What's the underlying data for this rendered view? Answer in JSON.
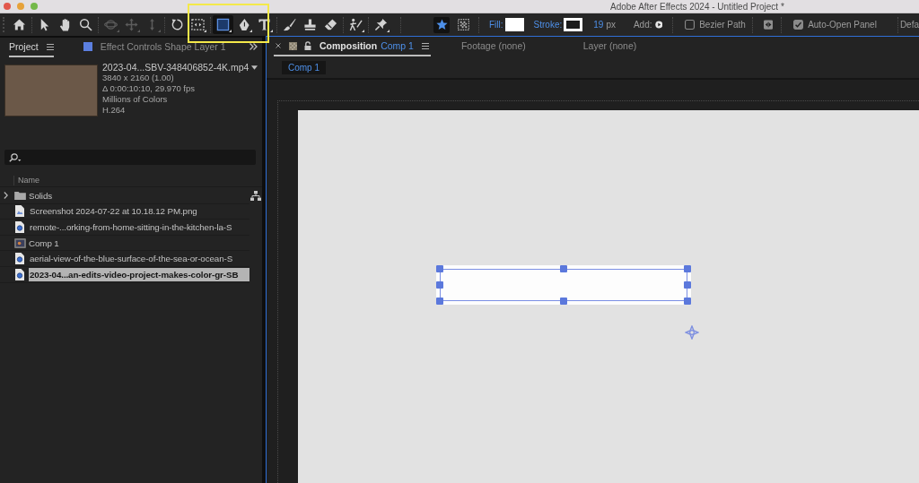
{
  "window": {
    "title": "Adobe After Effects 2024 - Untitled Project *",
    "controls": [
      {
        "color": "#e2574c"
      },
      {
        "color": "#e6a23a"
      },
      {
        "color": "#74b94a"
      }
    ]
  },
  "toolbar": {
    "tool_groups": [
      {
        "tools": [
          {
            "kind": "home",
            "selected": false,
            "disabled": false,
            "menu": false
          }
        ]
      },
      {
        "tools": [
          {
            "kind": "select",
            "selected": false,
            "disabled": false,
            "menu": false
          },
          {
            "kind": "hand",
            "selected": false,
            "disabled": false,
            "menu": false
          },
          {
            "kind": "zoom",
            "selected": false,
            "disabled": false,
            "menu": false
          }
        ]
      },
      {
        "tools": [
          {
            "kind": "orbit",
            "selected": false,
            "disabled": true,
            "menu": true
          },
          {
            "kind": "pan",
            "selected": false,
            "disabled": true,
            "menu": true
          },
          {
            "kind": "dolly",
            "selected": false,
            "disabled": true,
            "menu": true
          }
        ]
      },
      {
        "tools": [
          {
            "kind": "rotate",
            "selected": false,
            "disabled": false,
            "menu": false
          },
          {
            "kind": "pan_behind",
            "selected": false,
            "disabled": false,
            "menu": true
          }
        ]
      },
      {
        "tools": [
          {
            "kind": "rectangle",
            "selected": true,
            "disabled": false,
            "menu": true
          },
          {
            "kind": "pen",
            "selected": false,
            "disabled": false,
            "menu": true
          },
          {
            "kind": "type",
            "selected": false,
            "disabled": false,
            "menu": true
          }
        ]
      },
      {
        "tools": [
          {
            "kind": "brush",
            "selected": false,
            "disabled": false,
            "menu": false
          },
          {
            "kind": "stamp",
            "selected": false,
            "disabled": false,
            "menu": false
          },
          {
            "kind": "eraser",
            "selected": false,
            "disabled": false,
            "menu": false
          }
        ]
      },
      {
        "tools": [
          {
            "kind": "roto",
            "selected": false,
            "disabled": false,
            "menu": true
          }
        ]
      },
      {
        "tools": [
          {
            "kind": "pin",
            "selected": false,
            "disabled": false,
            "menu": true
          }
        ]
      }
    ],
    "modes": [
      {
        "kind": "shape",
        "selected": true
      },
      {
        "kind": "mask",
        "selected": false
      }
    ],
    "swatches": [
      {
        "kind": "fill",
        "label": "Fill:",
        "color": "#ffffff"
      },
      {
        "kind": "stroke",
        "label": "Stroke:",
        "color": "#ffffff"
      }
    ],
    "stroke_width": {
      "value": "19",
      "unit": "px"
    },
    "add": {
      "label": "Add:"
    },
    "bezier_path": {
      "label": "Bezier Path",
      "checked": false
    },
    "auto_open_panel": {
      "label": "Auto-Open Panel",
      "checked": true
    },
    "workspace": {
      "label": "Defa"
    }
  },
  "project_panel": {
    "tabs": [
      {
        "label": "Project",
        "selected": true,
        "menu": true
      },
      {
        "label": "Effect Controls Shape Layer 1",
        "selected": false,
        "menu": false,
        "color": "#5b7fe0"
      }
    ],
    "preview": {
      "name": "2023-04...SBV-348406852-4K.mp4",
      "details": [
        "3840 x 2160 (1.00)",
        "Δ 0:00:10:10, 29.970 fps",
        "Millions of Colors",
        "H.264"
      ]
    },
    "columns": [
      "Name"
    ],
    "items": [
      {
        "kind": "folder",
        "name": "Solids",
        "expanded": false,
        "selected": false
      },
      {
        "kind": "image",
        "name": "Screenshot 2024-07-22 at 10.18.12 PM.png",
        "selected": false
      },
      {
        "kind": "footage",
        "name": "remote-...orking-from-home-sitting-in-the-kitchen-la-S",
        "selected": false
      },
      {
        "kind": "comp",
        "name": "Comp 1",
        "selected": false
      },
      {
        "kind": "footage",
        "name": "aerial-view-of-the-blue-surface-of-the-sea-or-ocean-S",
        "selected": false
      },
      {
        "kind": "footage",
        "name": "2023-04...an-edits-video-project-makes-color-gr-SB",
        "selected": true
      }
    ]
  },
  "composition_panel": {
    "tabs": [
      {
        "kind": "composition",
        "label": "Composition",
        "name": "Comp 1",
        "selected": true,
        "locked": false
      },
      {
        "kind": "footage",
        "label": "Footage (none)",
        "selected": false
      },
      {
        "kind": "layer",
        "label": "Layer (none)",
        "selected": false
      }
    ],
    "breadcrumbs": [
      "Comp 1"
    ],
    "layers": [
      {
        "kind": "rectangle",
        "selected": true
      }
    ]
  },
  "highlight": {
    "shown": true
  }
}
